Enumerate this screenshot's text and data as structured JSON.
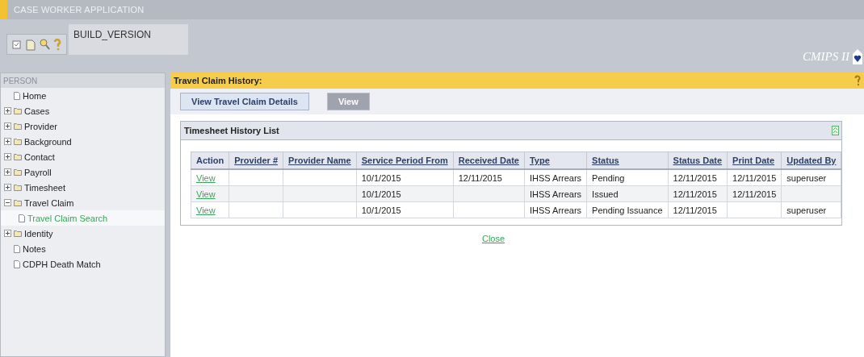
{
  "app_title": "CASE WORKER APPLICATION",
  "build_version": "BUILD_VERSION",
  "logo_text": "CMIPS II",
  "sidebar": {
    "title": "PERSON",
    "items": [
      {
        "label": "Home",
        "kind": "page",
        "selected": false
      },
      {
        "label": "Cases",
        "kind": "folder",
        "expanded": false,
        "selected": false
      },
      {
        "label": "Provider",
        "kind": "folder",
        "expanded": false,
        "selected": false
      },
      {
        "label": "Background",
        "kind": "folder",
        "expanded": false,
        "selected": false
      },
      {
        "label": "Contact",
        "kind": "folder",
        "expanded": false,
        "selected": false
      },
      {
        "label": "Payroll",
        "kind": "folder",
        "expanded": false,
        "selected": false
      },
      {
        "label": "Timesheet",
        "kind": "folder",
        "expanded": false,
        "selected": false
      },
      {
        "label": "Travel Claim",
        "kind": "folder",
        "expanded": true,
        "selected": false,
        "children": [
          {
            "label": "Travel Claim Search",
            "kind": "page",
            "selected": true
          }
        ]
      },
      {
        "label": "Identity",
        "kind": "folder",
        "expanded": false,
        "selected": false
      },
      {
        "label": "Notes",
        "kind": "page",
        "selected": false
      },
      {
        "label": "CDPH Death Match",
        "kind": "page",
        "selected": false
      }
    ]
  },
  "page_title": "Travel Claim History:",
  "buttons": [
    {
      "label": "View Travel Claim Details",
      "disabled": false
    },
    {
      "label": "View",
      "disabled": true
    }
  ],
  "panel": {
    "title": "Timesheet History List",
    "table": {
      "columns": [
        {
          "label": "Action",
          "sortable": false,
          "kind": "link"
        },
        {
          "label": "Provider #",
          "sortable": true
        },
        {
          "label": "Provider Name",
          "sortable": true
        },
        {
          "label": "Service Period From",
          "sortable": true
        },
        {
          "label": "Received Date",
          "sortable": true
        },
        {
          "label": "Type",
          "sortable": true
        },
        {
          "label": "Status",
          "sortable": true
        },
        {
          "label": "Status Date",
          "sortable": true
        },
        {
          "label": "Print Date",
          "sortable": true
        },
        {
          "label": "Updated By",
          "sortable": true
        }
      ],
      "rows": [
        {
          "cells": [
            "View",
            "",
            "",
            "10/1/2015",
            "12/11/2015",
            "IHSS Arrears",
            "Pending",
            "12/11/2015",
            "12/11/2015",
            "superuser"
          ]
        },
        {
          "cells": [
            "View",
            "",
            "",
            "10/1/2015",
            "",
            "IHSS Arrears",
            "Issued",
            "12/11/2015",
            "12/11/2015",
            ""
          ]
        },
        {
          "cells": [
            "View",
            "",
            "",
            "10/1/2015",
            "",
            "IHSS Arrears",
            "Pending Issuance",
            "12/11/2015",
            "",
            "superuser"
          ]
        }
      ]
    }
  },
  "close_link": "Close"
}
